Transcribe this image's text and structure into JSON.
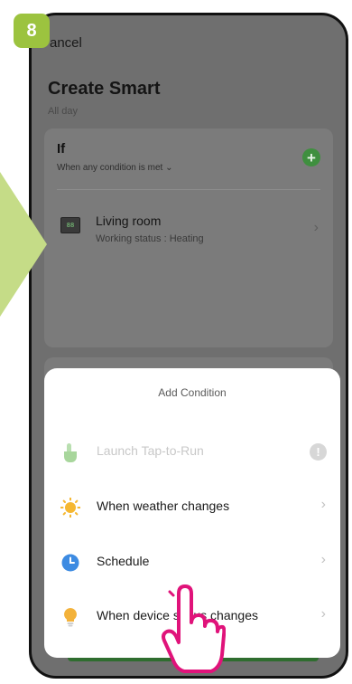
{
  "step_badge": "8",
  "header": {
    "cancel_label": "ancel",
    "title": "Create Smart",
    "subtitle": "All day"
  },
  "if_card": {
    "title": "If",
    "condition_mode": "When any condition is met",
    "dropdown_glyph": "⌄",
    "add_glyph": "+",
    "device": {
      "thermostat_display": "88",
      "name": "Living room",
      "status": "Working status : Heating"
    }
  },
  "sheet": {
    "title": "Add Condition",
    "options": [
      {
        "label": "Launch Tap-to-Run",
        "icon": "tap-hand-icon",
        "enabled": false,
        "trailing": "!"
      },
      {
        "label": "When weather changes",
        "icon": "sun-icon",
        "enabled": true,
        "trailing": "›"
      },
      {
        "label": "Schedule",
        "icon": "clock-icon",
        "enabled": true,
        "trailing": "›"
      },
      {
        "label": "When device status changes",
        "icon": "lightbulb-icon",
        "enabled": true,
        "trailing": "›"
      }
    ]
  },
  "chevron_glyph": "›",
  "colors": {
    "badge": "#9cc33f",
    "overlay": "#6f6f6f",
    "accent_green": "#3f8f3f",
    "sun": "#f5b731",
    "clock": "#3d8be2",
    "bulb": "#f3b23a",
    "hand": "#e0137a"
  }
}
